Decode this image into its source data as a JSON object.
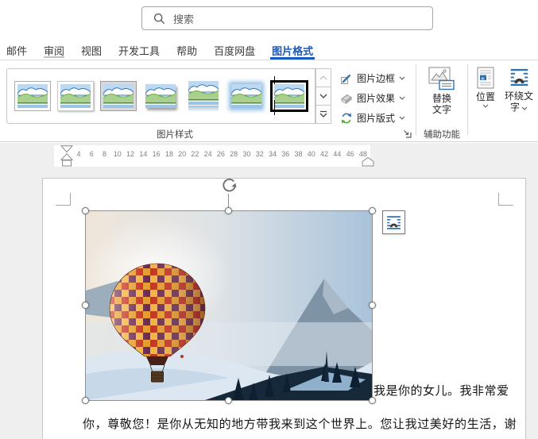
{
  "search": {
    "placeholder": "搜索"
  },
  "tabs": [
    {
      "label": "邮件"
    },
    {
      "label": "审阅",
      "underlined": true
    },
    {
      "label": "视图"
    },
    {
      "label": "开发工具"
    },
    {
      "label": "帮助"
    },
    {
      "label": "百度网盘"
    },
    {
      "label": "图片格式",
      "active": true
    }
  ],
  "ribbon": {
    "picture_styles": {
      "group_label": "图片样式",
      "styles": [
        {
          "icon": "style-simple-frame-white"
        },
        {
          "icon": "style-beveled-matte-white"
        },
        {
          "icon": "style-metal-frame"
        },
        {
          "icon": "style-drop-shadow-rectangle"
        },
        {
          "icon": "style-reflected-rounded-rectangle"
        },
        {
          "icon": "style-soft-edge-rectangle"
        },
        {
          "icon": "style-double-frame-black",
          "selected": true
        }
      ]
    },
    "tools": [
      {
        "label": "图片边框"
      },
      {
        "label": "图片效果"
      },
      {
        "label": "图片版式"
      }
    ],
    "accessibility": {
      "button_label": "替换文字",
      "group_label": "辅助功能"
    },
    "arrange": {
      "position_label": "位置",
      "wrap_label": "环绕文字"
    }
  },
  "ruler": {
    "numbers": [
      "4",
      "6",
      "8",
      "10",
      "12",
      "14",
      "16",
      "18",
      "20",
      "22",
      "24",
      "26",
      "28",
      "30",
      "32",
      "34",
      "36",
      "38",
      "40",
      "42",
      "44",
      "46",
      "48"
    ]
  },
  "document": {
    "text_line_1": "我是你的女儿。我非常爱",
    "text_line_2": "你，尊敬您！是你从无知的地方带我来到这个世界上。您让我过美好的生活，谢"
  },
  "colors": {
    "accent": "#185abd",
    "wrap_line_blue": "#2e74b5"
  }
}
